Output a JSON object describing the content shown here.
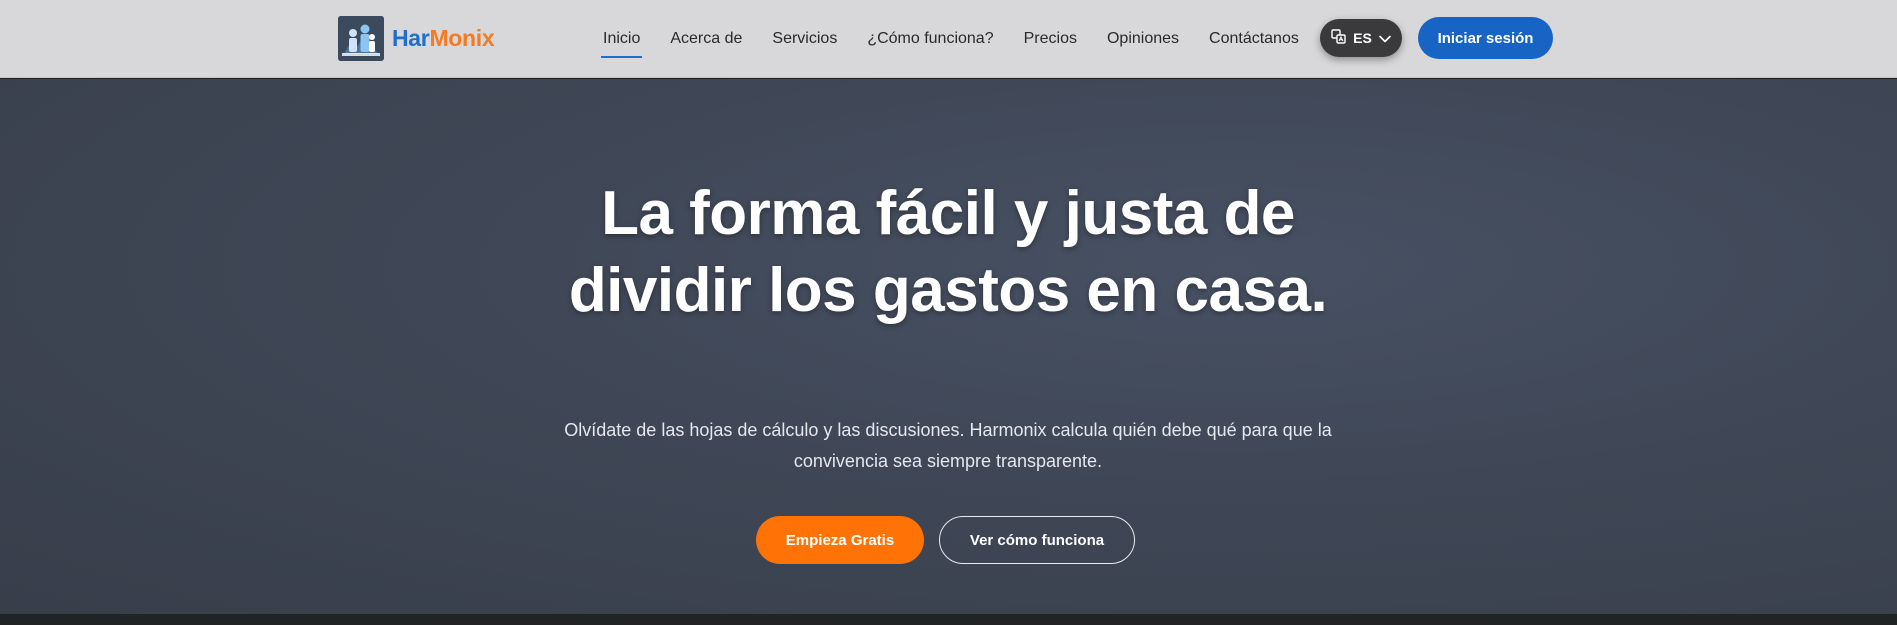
{
  "brand": {
    "name_part1": "Har",
    "name_part2": "Monix",
    "logo_icon": "family-logo-icon",
    "colors": {
      "har": "#1e6fc9",
      "monix": "#f47b20"
    }
  },
  "nav": {
    "items": [
      {
        "label": "Inicio",
        "active": true
      },
      {
        "label": "Acerca de"
      },
      {
        "label": "Servicios"
      },
      {
        "label": "¿Cómo funciona?"
      },
      {
        "label": "Precios"
      },
      {
        "label": "Opiniones"
      },
      {
        "label": "Contáctanos"
      }
    ]
  },
  "language": {
    "code": "ES",
    "icon": "translate-icon",
    "chevron": "chevron-down-icon"
  },
  "login": {
    "label": "Iniciar sesión",
    "color": "#1864c4"
  },
  "hero": {
    "title": "La forma fácil y justa de dividir los gastos en casa.",
    "subtitle": "Olvídate de las hojas de cálculo y las discusiones. Harmonix calcula quién debe qué para que la convivencia sea siempre transparente.",
    "primary_cta": "Empieza Gratis",
    "secondary_cta": "Ver cómo funciona",
    "colors": {
      "primary_cta": "#ff7306",
      "background": "#404756"
    }
  }
}
